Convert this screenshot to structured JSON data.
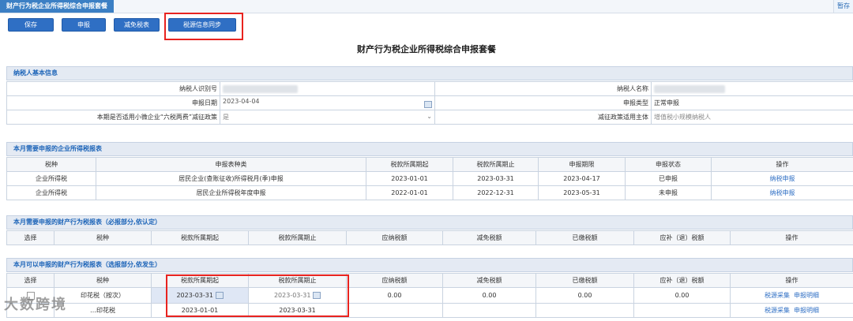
{
  "window": {
    "tab_title": "财产行为税企业所得税综合申报套餐",
    "right_label": "暂存"
  },
  "toolbar": {
    "save": "保存",
    "declare": "申报",
    "relief": "减免税表",
    "sync": "税源信息同步"
  },
  "page_title": "财产行为税企业所得税综合申报套餐",
  "taxpayer": {
    "section_title": "纳税人基本信息",
    "id_label": "纳税人识别号",
    "name_label": "纳税人名称",
    "date_label": "申报日期",
    "date_value": "2023-04-04",
    "type_label": "申报类型",
    "type_value": "正常申报",
    "policy_label": "本期是否适用小微企业“六税两费”减征政策",
    "policy_value": "是",
    "subject_label": "减征政策适用主体",
    "subject_value": "增值税小规模纳税人"
  },
  "monthly": {
    "section_title": "本月需要申报的企业所得税报表",
    "headers": [
      "税种",
      "申报表种类",
      "税款所属期起",
      "税款所属期止",
      "申报期限",
      "申报状态",
      "操作"
    ],
    "rows": [
      {
        "tax": "企业所得税",
        "form": "居民企业(查账征收)所得税月(季)申报",
        "start": "2023-01-01",
        "end": "2023-03-31",
        "deadline": "2023-04-17",
        "status": "已申报",
        "action": "纳税申报"
      },
      {
        "tax": "企业所得税",
        "form": "居民企业所得税年度申报",
        "start": "2022-01-01",
        "end": "2022-12-31",
        "deadline": "2023-05-31",
        "status": "未申报",
        "action": "纳税申报"
      }
    ]
  },
  "required": {
    "section_title": "本月需要申报的财产行为税报表（必报部分,依认定）",
    "headers": [
      "选择",
      "税种",
      "税款所属期起",
      "税款所属期止",
      "应纳税额",
      "减免税额",
      "已缴税额",
      "应补（退）税额",
      "操作"
    ]
  },
  "optional": {
    "section_title": "本月可以申报的财产行为税报表（选报部分,依发生）",
    "headers": [
      "选择",
      "税种",
      "税款所属期起",
      "税款所属期止",
      "应纳税额",
      "减免税额",
      "已缴税额",
      "应补（退）税额",
      "操作"
    ],
    "rows": [
      {
        "tax": "印花税（按次）",
        "start": "2023-03-31",
        "end": "2023-03-31",
        "payable": "0.00",
        "relief": "0.00",
        "paid": "0.00",
        "due": "0.00",
        "action1": "税源采集",
        "action2": "申报明细"
      },
      {
        "tax": "…印花税",
        "start": "2023-01-01",
        "end": "2023-03-31",
        "payable": "",
        "relief": "",
        "paid": "",
        "due": "",
        "action1": "税源采集",
        "action2": "申报明细"
      }
    ]
  },
  "watermark": "大数跨境"
}
